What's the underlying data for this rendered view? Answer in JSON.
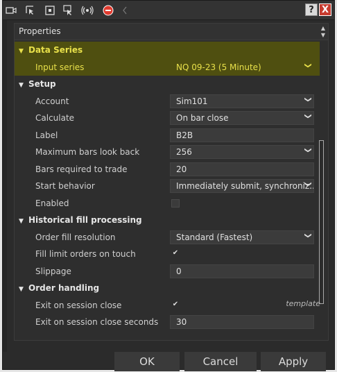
{
  "toolbar": {
    "icons": [
      "screen-capture-icon",
      "pointer-icon",
      "select-box-icon",
      "pointer-list-icon",
      "radio-icon",
      "stop-icon",
      "chevron-left-icon"
    ],
    "help_label": "?",
    "close_label": "X"
  },
  "panel": {
    "title": "Properties"
  },
  "sections": {
    "data_series": {
      "title": "Data Series",
      "input_series_label": "Input series",
      "input_series_value": "NQ 09-23 (5 Minute)"
    },
    "setup": {
      "title": "Setup",
      "account_label": "Account",
      "account_value": "Sim101",
      "calculate_label": "Calculate",
      "calculate_value": "On bar close",
      "label_label": "Label",
      "label_value": "B2B",
      "max_bars_label": "Maximum bars look back",
      "max_bars_value": "256",
      "bars_required_label": "Bars required to trade",
      "bars_required_value": "20",
      "start_behavior_label": "Start behavior",
      "start_behavior_value": "Immediately submit, synchroniz...",
      "enabled_label": "Enabled"
    },
    "historical": {
      "title": "Historical fill processing",
      "order_fill_label": "Order fill resolution",
      "order_fill_value": "Standard (Fastest)",
      "fill_limit_label": "Fill limit orders on touch",
      "slippage_label": "Slippage",
      "slippage_value": "0"
    },
    "order_handling": {
      "title": "Order handling",
      "exit_close_label": "Exit on session close",
      "exit_seconds_label": "Exit on session close seconds",
      "exit_seconds_value": "30"
    }
  },
  "template_label": "template",
  "buttons": {
    "ok": "OK",
    "cancel": "Cancel",
    "apply": "Apply"
  },
  "glyphs": {
    "expanded": "▼",
    "chevron": "❯",
    "check": "✔"
  }
}
